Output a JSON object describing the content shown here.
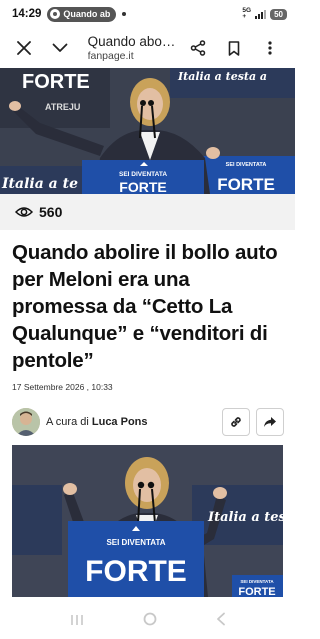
{
  "status_bar": {
    "time": "14:29",
    "notification_pill": "Quando ab",
    "network_label_top": "5G",
    "network_label_bottom": "+",
    "battery": "50"
  },
  "toolbar": {
    "page_title": "Quando abo…",
    "url": "fanpage.it",
    "close_icon": "close-icon",
    "chevron_icon": "chevron-down-icon",
    "share_icon": "share-icon",
    "bookmark_icon": "bookmark-icon",
    "more_icon": "more-vert-icon"
  },
  "hero": {
    "banner_left": "FORTE",
    "banner_sub": "ATREJU",
    "banner_right": "Italia a testa a",
    "podium_sign_top": "SEI DIVENTATA",
    "podium_sign_main": "FORTE",
    "sign_right_top": "SEI DIVENTATA",
    "sign_right_main": "FORTE",
    "italia_left": "Italia a te"
  },
  "views": {
    "icon": "eye-icon",
    "count": "560"
  },
  "article": {
    "headline": "Quando abolire il bollo auto per Meloni era una promessa da “Cetto La Qualunque” e “venditori di pentole”",
    "date": "17 Settembre 2026 , 10:33",
    "author_prefix": "A cura di",
    "author_name": "Luca Pons",
    "link_icon": "link-icon",
    "share_icon": "share-arrow-icon"
  },
  "article_image": {
    "banner_right": "Italia a testa",
    "podium_sign_top": "SEI DIVENTATA",
    "podium_sign_main": "FORTE",
    "sign_right_top": "SEI DIVENTATA",
    "sign_right_main": "FORTE"
  },
  "nav_bar": {
    "recents_icon": "recents-icon",
    "home_icon": "home-icon",
    "back_icon": "back-icon"
  },
  "colors": {
    "podium_blue": "#1f4fa8",
    "stage_dark": "#3b4150",
    "views_bg": "#f2f2f2"
  }
}
